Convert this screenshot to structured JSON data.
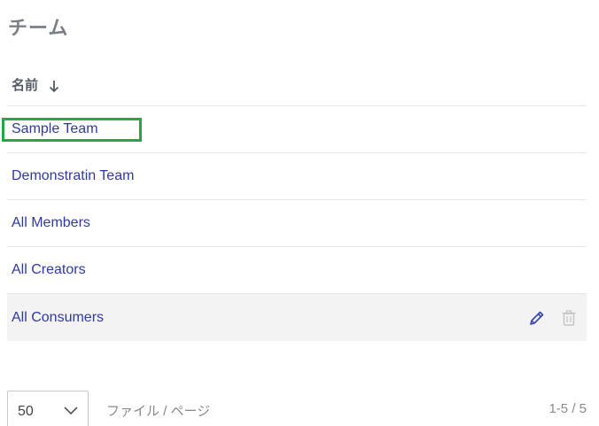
{
  "page": {
    "title": "チーム"
  },
  "table": {
    "column_header": "名前",
    "sort_icon": "arrow-down-icon",
    "rows": [
      {
        "name": "Sample Team"
      },
      {
        "name": "Demonstratin Team"
      },
      {
        "name": "All Members"
      },
      {
        "name": "All Creators"
      },
      {
        "name": "All Consumers"
      }
    ],
    "row_actions": {
      "edit_icon": "pencil-icon",
      "delete_icon": "trash-icon"
    }
  },
  "pagination": {
    "page_size": "50",
    "per_page_label": "ファイル / ページ",
    "range": "1-5 / 5"
  },
  "colors": {
    "link": "#2e39a6",
    "highlight": "#21a84a",
    "hover_row": "#f3f3f3",
    "edit_icon": "#3a44b0",
    "delete_icon": "#c4c4c4"
  }
}
